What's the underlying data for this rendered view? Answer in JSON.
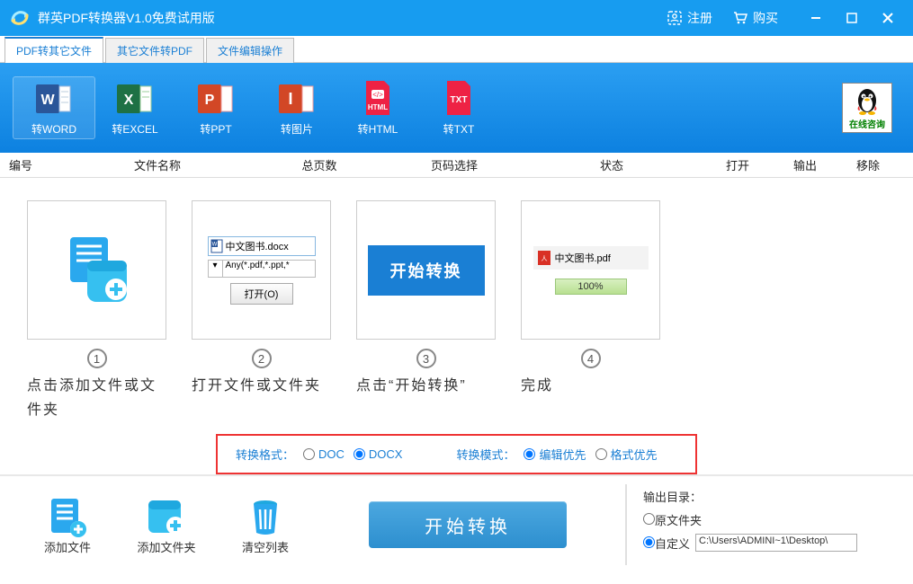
{
  "titlebar": {
    "title": "群英PDF转换器V1.0免费试用版",
    "register": "注册",
    "buy": "购买"
  },
  "tabs": [
    "PDF转其它文件",
    "其它文件转PDF",
    "文件编辑操作"
  ],
  "tools": {
    "word": "转WORD",
    "excel": "转EXCEL",
    "ppt": "转PPT",
    "image": "转图片",
    "html": "转HTML",
    "txt": "转TXT",
    "qq": "在线咨询"
  },
  "headers": {
    "num": "编号",
    "name": "文件名称",
    "pages": "总页数",
    "pagesel": "页码选择",
    "status": "状态",
    "open": "打开",
    "output": "输出",
    "remove": "移除"
  },
  "steps": {
    "s1": "点击添加文件或文件夹",
    "s2": "打开文件或文件夹",
    "s2_file": "中文图书.docx",
    "s2_filter": "Any(*.pdf,*.ppt,*",
    "s2_open": "打开(O)",
    "s3": "点击“开始转换”",
    "s3_btn": "开始转换",
    "s4": "完成",
    "s4_file": "中文图书.pdf",
    "s4_progress": "100%"
  },
  "options": {
    "format_label": "转换格式：",
    "doc": "DOC",
    "docx": "DOCX",
    "mode_label": "转换模式：",
    "edit_first": "编辑优先",
    "layout_first": "格式优先"
  },
  "bottom": {
    "add_file": "添加文件",
    "add_folder": "添加文件夹",
    "clear": "清空列表",
    "start": "开始转换",
    "out_label": "输出目录：",
    "same_folder": "原文件夹",
    "custom": "自定义",
    "path": "C:\\Users\\ADMINI~1\\Desktop\\"
  }
}
